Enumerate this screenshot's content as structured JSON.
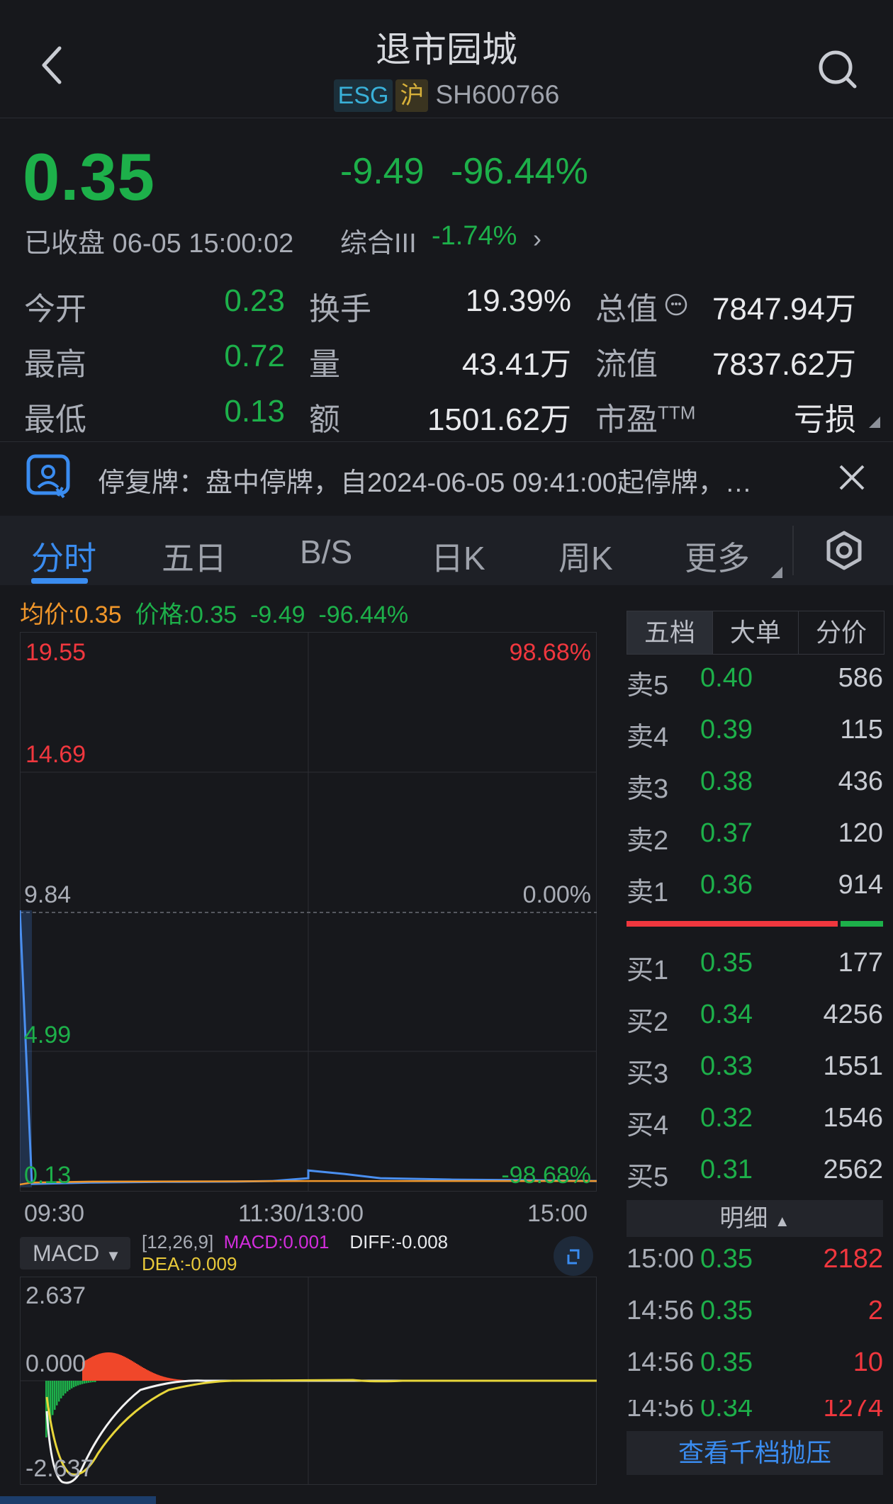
{
  "header": {
    "title": "退市园城",
    "esg_tag": "ESG",
    "exchange_tag": "沪",
    "code": "SH600766"
  },
  "quote": {
    "price": "0.35",
    "change": "-9.49",
    "change_pct": "-96.44%",
    "status": "已收盘 06-05 15:00:02",
    "index_name": "综合III",
    "index_change": "-1.74%"
  },
  "stats": [
    {
      "label": "今开",
      "value": "0.23"
    },
    {
      "label": "最高",
      "value": "0.72"
    },
    {
      "label": "最低",
      "value": "0.13"
    },
    {
      "label": "换手",
      "value": "19.39%"
    },
    {
      "label": "量",
      "value": "43.41万"
    },
    {
      "label": "额",
      "value": "1501.62万"
    },
    {
      "label": "总值",
      "value": "7847.94万"
    },
    {
      "label": "流值",
      "value": "7837.62万"
    },
    {
      "label": "市盈",
      "sup": "TTM",
      "value": "亏损"
    }
  ],
  "notice": {
    "text": "停复牌：盘中停牌，自2024-06-05 09:41:00起停牌，…"
  },
  "tabs": [
    "分时",
    "五日",
    "B/S",
    "日K",
    "周K",
    "更多"
  ],
  "chart": {
    "avg_price": "均价:0.35",
    "price_label": "价格:0.35",
    "change": "-9.49",
    "change_pct": "-96.44%",
    "y_labels": [
      "19.55",
      "14.69",
      "9.84",
      "4.99",
      "0.13"
    ],
    "pct_labels": [
      "98.68%",
      "0.00%",
      "-98.68%"
    ],
    "x_labels": [
      "09:30",
      "11:30/13:00",
      "15:00"
    ]
  },
  "chart_data": {
    "type": "line",
    "title": "",
    "xlabel": "",
    "ylabel": "",
    "ylim": [
      0.13,
      19.55
    ],
    "prev_close": 9.84,
    "x_ticks": [
      "09:30",
      "11:30/13:00",
      "15:00"
    ],
    "series": [
      {
        "name": "价格",
        "x": [
          "09:30",
          "09:35",
          "10:00",
          "10:30",
          "11:00",
          "11:15",
          "11:30",
          "13:00",
          "13:15",
          "13:30",
          "14:00",
          "14:30",
          "15:00"
        ],
        "values": [
          9.84,
          0.25,
          0.3,
          0.32,
          0.33,
          0.35,
          0.45,
          0.72,
          0.6,
          0.45,
          0.4,
          0.38,
          0.35
        ]
      },
      {
        "name": "均价",
        "x": [
          "09:30",
          "09:35",
          "10:00",
          "11:00",
          "13:00",
          "14:00",
          "15:00"
        ],
        "values": [
          0.23,
          0.3,
          0.33,
          0.34,
          0.35,
          0.35,
          0.35
        ]
      }
    ]
  },
  "macd": {
    "selector": "MACD",
    "params": "[12,26,9]",
    "macd_value": "MACD:0.001",
    "diff_value": "DIFF:-0.008",
    "dea_value": "DEA:-0.009",
    "y_labels": [
      "2.637",
      "0.000",
      "-2.637"
    ]
  },
  "order_book": {
    "tabs": [
      "五档",
      "大单",
      "分价"
    ],
    "asks": [
      {
        "label": "卖5",
        "price": "0.40",
        "volume": "586"
      },
      {
        "label": "卖4",
        "price": "0.39",
        "volume": "115"
      },
      {
        "label": "卖3",
        "price": "0.38",
        "volume": "436"
      },
      {
        "label": "卖2",
        "price": "0.37",
        "volume": "120"
      },
      {
        "label": "卖1",
        "price": "0.36",
        "volume": "914"
      }
    ],
    "bids": [
      {
        "label": "买1",
        "price": "0.35",
        "volume": "177"
      },
      {
        "label": "买2",
        "price": "0.34",
        "volume": "4256"
      },
      {
        "label": "买3",
        "price": "0.33",
        "volume": "1551"
      },
      {
        "label": "买4",
        "price": "0.32",
        "volume": "1546"
      },
      {
        "label": "买5",
        "price": "0.31",
        "volume": "2562"
      }
    ]
  },
  "details": {
    "header": "明细",
    "rows": [
      {
        "time": "15:00",
        "price": "0.35",
        "volume": "2182"
      },
      {
        "time": "14:56",
        "price": "0.35",
        "volume": "2"
      },
      {
        "time": "14:56",
        "price": "0.35",
        "volume": "10"
      }
    ],
    "partial_row": {
      "time": "14:56",
      "price": "0.34",
      "volume": "1274"
    },
    "depth_button": "查看千档抛压"
  }
}
